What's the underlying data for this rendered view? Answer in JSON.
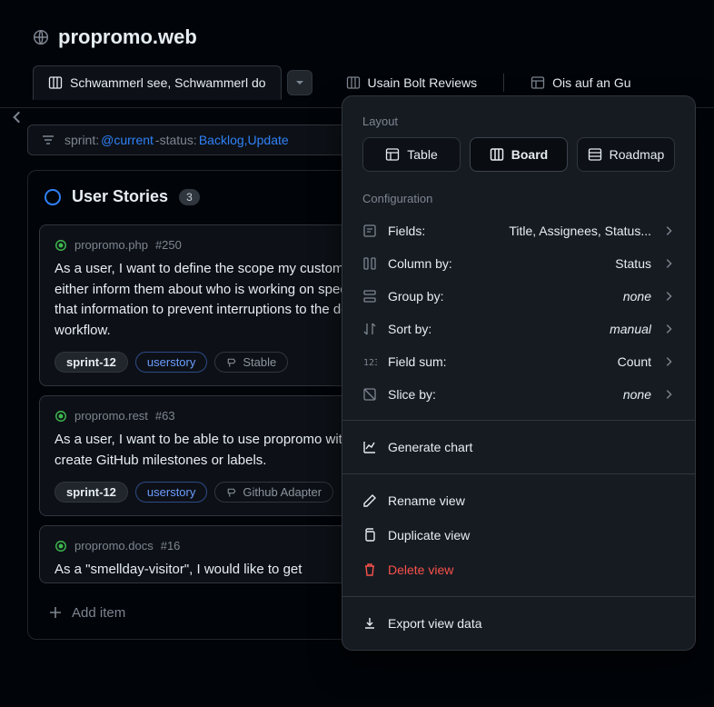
{
  "header": {
    "repo": "propromo.web"
  },
  "tabs": [
    {
      "label": "Schwammerl see, Schwammerl do"
    },
    {
      "label": "Usain Bolt Reviews"
    },
    {
      "label": "Ois auf an Gu"
    }
  ],
  "filter": {
    "prefix": "sprint:",
    "val1": "@current",
    "mid": " -status:",
    "val2": "Backlog,Update"
  },
  "column": {
    "title": "User Stories",
    "count": "3",
    "add_label": "Add item"
  },
  "cards": [
    {
      "repo": "propromo.php",
      "num": "#250",
      "body": "As a user, I want to define the scope my customer sees, so I can either inform them about who is working on specific tasks or hide that information to prevent interruptions to the developers' workflow.",
      "sprint": "sprint-12",
      "story": "userstory",
      "extra": "Stable"
    },
    {
      "repo": "propromo.rest",
      "num": "#63",
      "body": "As a user, I want to be able to use propromo without having to create GitHub milestones or labels.",
      "sprint": "sprint-12",
      "story": "userstory",
      "extra": "Github Adapter"
    },
    {
      "repo": "propromo.docs",
      "num": "#16",
      "body": "As a \"smellday-visitor\", I would like to get",
      "sprint": "",
      "story": "",
      "extra": ""
    }
  ],
  "popover": {
    "layout_label": "Layout",
    "layouts": {
      "table": "Table",
      "board": "Board",
      "roadmap": "Roadmap"
    },
    "config_label": "Configuration",
    "rows": {
      "fields": {
        "label": "Fields:",
        "value": "Title, Assignees, Status..."
      },
      "column": {
        "label": "Column by:",
        "value": "Status"
      },
      "group": {
        "label": "Group by:",
        "value": "none"
      },
      "sort": {
        "label": "Sort by:",
        "value": "manual"
      },
      "sum": {
        "label": "Field sum:",
        "value": "Count"
      },
      "slice": {
        "label": "Slice by:",
        "value": "none"
      }
    },
    "actions": {
      "chart": "Generate chart",
      "rename": "Rename view",
      "duplicate": "Duplicate view",
      "delete": "Delete view",
      "export": "Export view data"
    }
  }
}
